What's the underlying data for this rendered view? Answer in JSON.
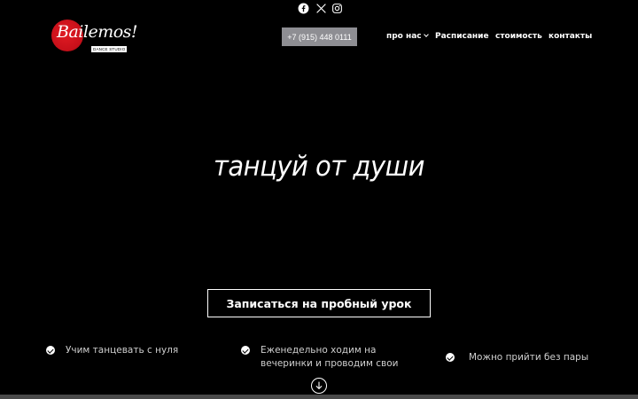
{
  "social": {
    "icons": [
      "facebook-icon",
      "x-icon",
      "instagram-icon"
    ]
  },
  "brand": {
    "logo_script": "Bailemos!",
    "logo_sub": "DANCE STUDIO",
    "accent_color": "#e11b23"
  },
  "header": {
    "phone_label": "+7 (915) 448 0111",
    "phone_bg": "#8e8e93",
    "nav": [
      {
        "label": "про нас",
        "has_dropdown": true
      },
      {
        "label": "Расписание"
      },
      {
        "label": "стоимость"
      },
      {
        "label": "контакты"
      }
    ]
  },
  "hero": {
    "title": "танцуй от души",
    "cta_label": "Записаться на пробный урок"
  },
  "features": [
    {
      "text_lines": [
        "Учим танцевать с нуля"
      ]
    },
    {
      "text_lines": [
        "Еженедельно ходим на",
        "вечеринки и проводим свои"
      ]
    },
    {
      "text_lines": [
        "Можно прийти без пары"
      ]
    }
  ],
  "scroll": {
    "icon": "arrow-down-circle-icon"
  }
}
